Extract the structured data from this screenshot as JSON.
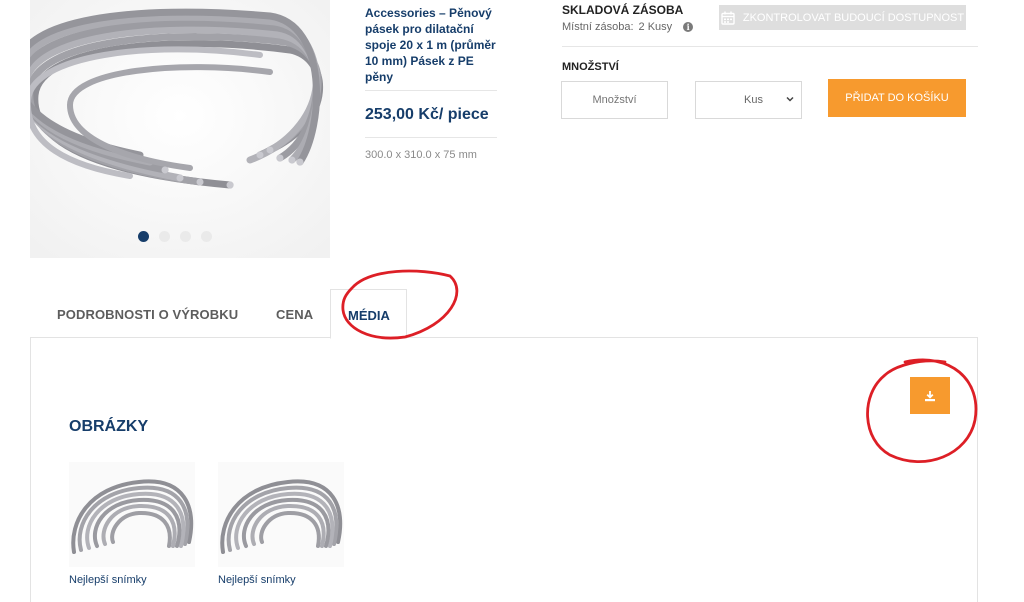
{
  "product": {
    "name": "Accessories  – Pěnový pásek pro dilatační spoje 20 x 1 m (průměr 10 mm) Pásek z PE pěny",
    "price": "253,00 Kč/ piece",
    "dimensions": "300.0 x 310.0 x 75 mm"
  },
  "gallery": {
    "dot_count": 4,
    "active_index": 0
  },
  "stock": {
    "title": "SKLADOVÁ ZÁSOBA",
    "local_label": "Místní zásoba:",
    "local_value": "2 Kusy",
    "future_availability_label": "ZKONTROLOVAT BUDOUCÍ DOSTUPNOST"
  },
  "order": {
    "quantity_title": "MNOŽSTVÍ",
    "quantity_placeholder": "Množství",
    "unit_selected": "Kus",
    "add_to_cart_label": "PŘIDAT DO KOŠÍKU"
  },
  "tabs": [
    {
      "label": "PODROBNOSTI O VÝROBKU"
    },
    {
      "label": "CENA"
    },
    {
      "label": "MÉDIA",
      "active": true
    }
  ],
  "media": {
    "heading": "OBRÁZKY",
    "images": [
      {
        "caption": "Nejlepší snímky"
      },
      {
        "caption": "Nejlepší snímky"
      }
    ]
  },
  "icons": {
    "calendar": "calendar-icon",
    "info": "info-icon",
    "chevron": "chevron-down-icon",
    "download": "download-icon"
  },
  "colors": {
    "brand_blue": "#163d6a",
    "accent_orange": "#f79a2e",
    "annotation_red": "#dd1f26"
  }
}
